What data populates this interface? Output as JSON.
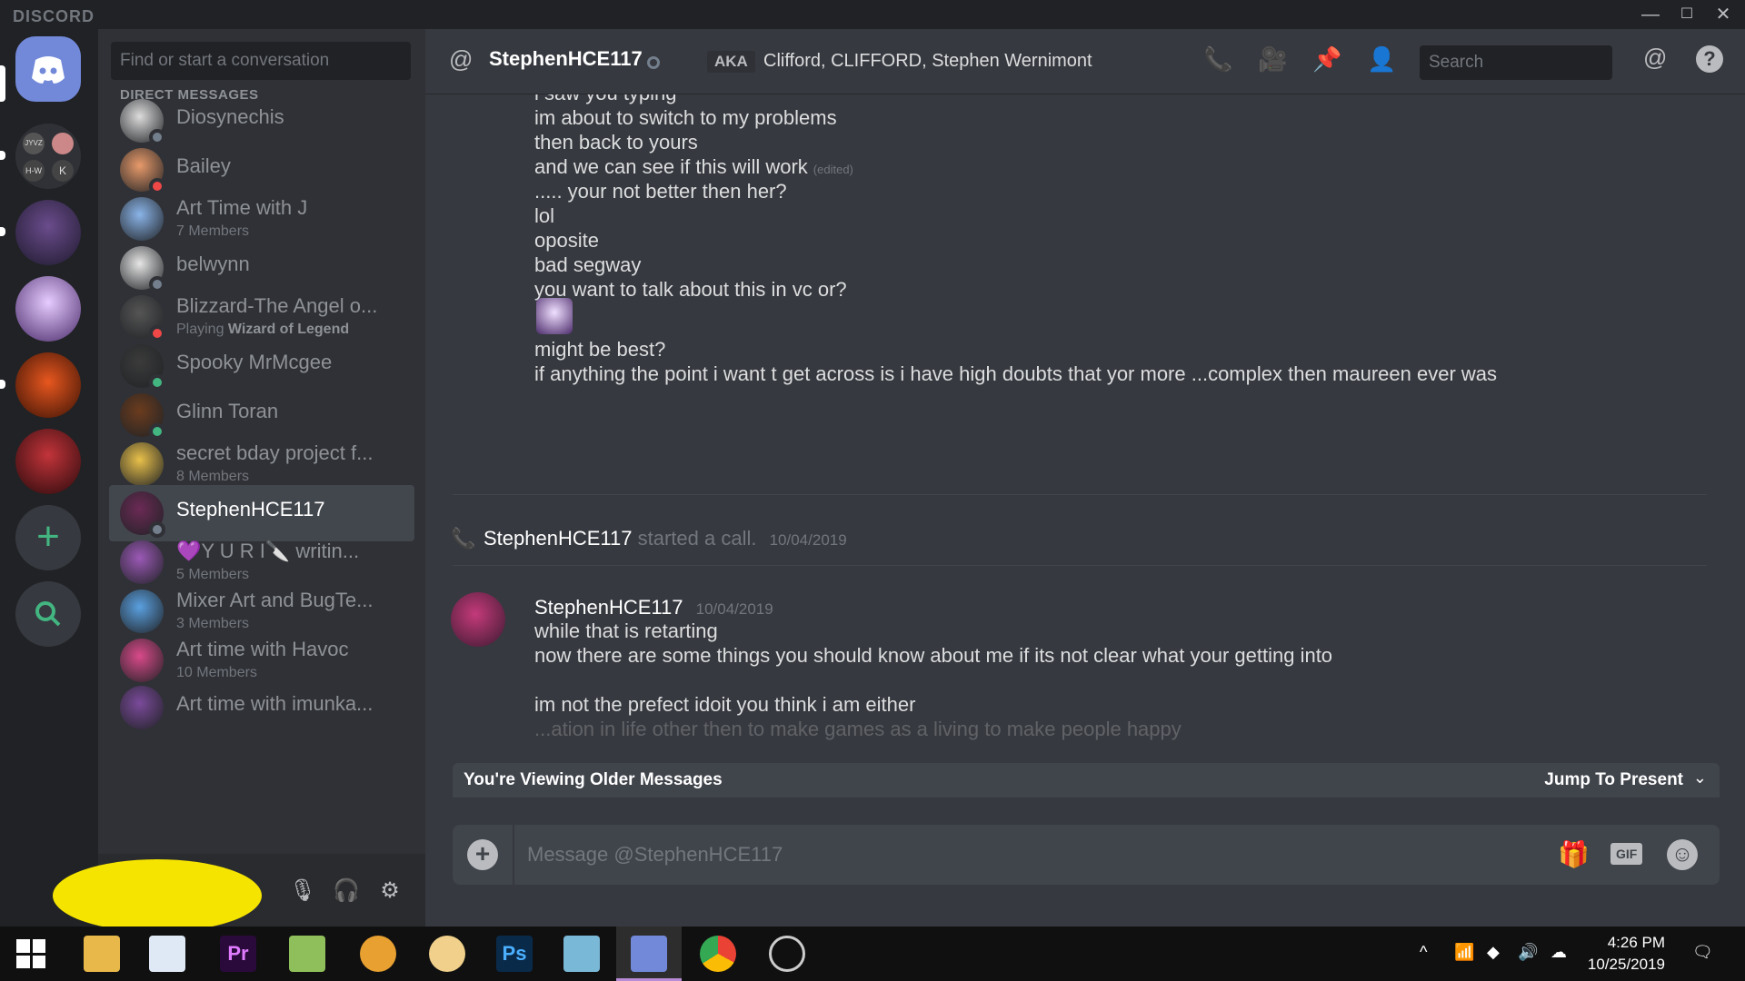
{
  "window": {
    "brand": "DISCORD",
    "min": "—",
    "max": "☐",
    "close": "✕"
  },
  "dm": {
    "search_placeholder": "Find or start a conversation",
    "header": "DIRECT MESSAGES",
    "items": [
      {
        "name": "Diosynechis",
        "sub": "",
        "avatar": "#dcdcdc",
        "status": "#747f8d"
      },
      {
        "name": "Bailey",
        "sub": "",
        "avatar": "#e89a6a",
        "status": "#f04747"
      },
      {
        "name": "Art Time with J",
        "sub": "7 Members",
        "avatar": "#8ab4e8",
        "status": ""
      },
      {
        "name": "belwynn",
        "sub": "",
        "avatar": "#e6e6e6",
        "status": "#747f8d"
      },
      {
        "name": "Blizzard-The Angel o...",
        "sub_prefix": "Playing ",
        "sub_bold": "Wizard of Legend",
        "avatar": "#555",
        "status": "#f04747"
      },
      {
        "name": "Spooky MrMcgee",
        "sub": "",
        "avatar": "#3b3b3b",
        "status": "#43b581"
      },
      {
        "name": "Glinn Toran",
        "sub": "",
        "avatar": "#6b3c1e",
        "status": "#43b581"
      },
      {
        "name": "secret bday project f...",
        "sub": "8 Members",
        "avatar": "#e8c04a",
        "status": ""
      },
      {
        "name": "StephenHCE117",
        "sub": "",
        "avatar": "#6b2a55",
        "status": "#747f8d"
      },
      {
        "name": "💜Y U R I🔪 writin...",
        "sub": "5 Members",
        "avatar": "#9b59b6",
        "status": ""
      },
      {
        "name": "Mixer Art and BugTe...",
        "sub": "3 Members",
        "avatar": "#5aa0e0",
        "status": ""
      },
      {
        "name": "Art time with Havoc",
        "sub": "10 Members",
        "avatar": "#d94a8a",
        "status": ""
      },
      {
        "name": "Art time with imunka...",
        "sub": "",
        "avatar": "#7a4a9a",
        "status": ""
      }
    ]
  },
  "header": {
    "at": "@",
    "name": "StephenHCE117",
    "aka": "AKA",
    "aka_names": "Clifford, CLIFFORD, Stephen Wernimont",
    "search_placeholder": "Search"
  },
  "messages": {
    "lines_a": [
      "i saw you typing",
      "im about to switch to my problems",
      "then back to yours",
      "and we can see if this will work",
      "..... your not better then her?",
      "lol",
      "oposite",
      "bad segway",
      "you want to talk about this in vc or?",
      "might be best?",
      "if anything the point i want t get across is i have high doubts that yor more ...complex then maureen ever was"
    ],
    "edited": "(edited)",
    "system_author": "StephenHCE117",
    "system_text": "started a call.",
    "system_ts": "10/04/2019",
    "group_author": "StephenHCE117",
    "group_ts": "10/04/2019",
    "lines_b": [
      "while that is retarting",
      "now there are some things you should know about me if its not clear what your getting into",
      "",
      "im not the prefect idoit you think i am either",
      "...ation in life other then to make games as a living to make people happy"
    ]
  },
  "older_bar": {
    "left": "You're Viewing Older Messages",
    "right": "Jump To Present"
  },
  "composer": {
    "placeholder": "Message @StephenHCE117"
  },
  "clock": {
    "time": "4:26 PM",
    "date": "10/25/2019"
  },
  "colors": {
    "blurple": "#7289da",
    "green": "#43b581",
    "dnd": "#f04747"
  }
}
